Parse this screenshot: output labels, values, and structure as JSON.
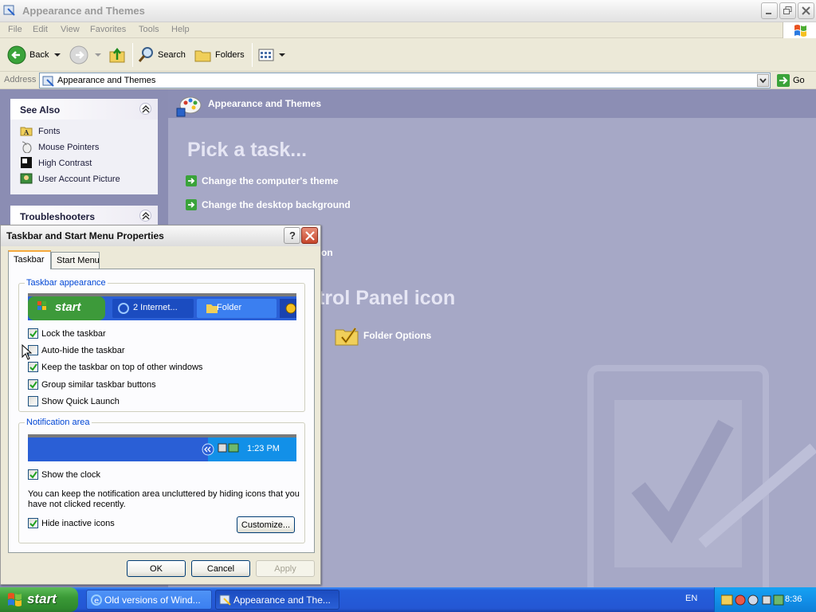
{
  "window": {
    "title": "Appearance and Themes",
    "menu": [
      "File",
      "Edit",
      "View",
      "Favorites",
      "Tools",
      "Help"
    ],
    "toolbar": {
      "back": "Back",
      "search": "Search",
      "folders": "Folders"
    },
    "address": {
      "label": "Address",
      "value": "Appearance and Themes",
      "go": "Go"
    }
  },
  "see_also": {
    "title": "See Also",
    "items": [
      "Fonts",
      "Mouse Pointers",
      "High Contrast",
      "User Account Picture"
    ]
  },
  "troubleshooters": {
    "title": "Troubleshooters"
  },
  "main": {
    "header": "Appearance and Themes",
    "pick_task": "Pick a task...",
    "tasks": [
      "Change the computer's theme",
      "Change the desktop background"
    ],
    "partial_task_tail": "on",
    "partial_heading": "trol Panel icon",
    "cp_icon": "Folder Options"
  },
  "dialog": {
    "title": "Taskbar and Start Menu Properties",
    "help": "?",
    "tabs": [
      "Taskbar",
      "Start Menu"
    ],
    "taskbar_appearance": {
      "legend": "Taskbar appearance",
      "preview": {
        "start": "start",
        "item1": "2 Internet...",
        "item2": "Folder"
      },
      "options": [
        {
          "label": "Lock the taskbar",
          "checked": true
        },
        {
          "label": "Auto-hide the taskbar",
          "checked": false
        },
        {
          "label": "Keep the taskbar on top of other windows",
          "checked": true
        },
        {
          "label": "Group similar taskbar buttons",
          "checked": true
        },
        {
          "label": "Show Quick Launch",
          "checked": false
        }
      ]
    },
    "notification_area": {
      "legend": "Notification area",
      "preview_time": "1:23 PM",
      "show_clock": {
        "label": "Show the clock",
        "checked": true
      },
      "note": "You can keep the notification area uncluttered by hiding icons that you have not clicked recently.",
      "hide_inactive": {
        "label": "Hide inactive icons",
        "checked": true
      },
      "customize": "Customize..."
    },
    "buttons": {
      "ok": "OK",
      "cancel": "Cancel",
      "apply": "Apply"
    }
  },
  "taskbar": {
    "start": "start",
    "items": [
      "Old versions of Wind...",
      "Appearance and The..."
    ],
    "language": "EN",
    "clock": "8:36"
  }
}
